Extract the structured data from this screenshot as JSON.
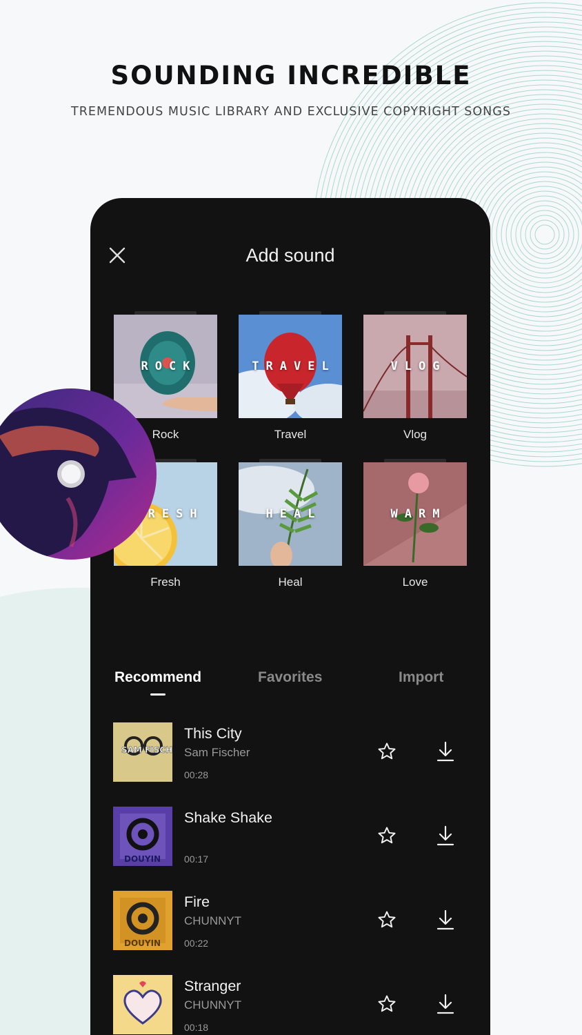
{
  "page": {
    "headline": "SOUNDING INCREDIBLE",
    "subline": "TREMENDOUS MUSIC LIBRARY AND EXCLUSIVE COPYRIGHT SONGS"
  },
  "colors": {
    "phone_bg": "#121212",
    "page_bg": "#f6f8fa",
    "ring_color": "#a9d8d0",
    "accent_white": "#ffffff",
    "muted_text": "#9a9a9a"
  },
  "screen": {
    "title": "Add sound",
    "close_icon": "close-icon",
    "categories": [
      {
        "label": "Rock",
        "cover_word": "ROCK"
      },
      {
        "label": "Travel",
        "cover_word": "TRAVEL"
      },
      {
        "label": "Vlog",
        "cover_word": "VLOG"
      },
      {
        "label": "Fresh",
        "cover_word": "FRESH"
      },
      {
        "label": "Heal",
        "cover_word": "HEAL"
      },
      {
        "label": "Love",
        "cover_word": "WARM"
      }
    ],
    "tabs": [
      {
        "label": "Recommend",
        "active": true
      },
      {
        "label": "Favorites",
        "active": false
      },
      {
        "label": "Import",
        "active": false
      }
    ],
    "songs": [
      {
        "title": "This City",
        "artist": "Sam Fischer",
        "duration": "00:28",
        "cover_text": "SAM FISCHER"
      },
      {
        "title": "Shake Shake",
        "artist": "",
        "duration": "00:17",
        "cover_text": "DOUYIN"
      },
      {
        "title": "Fire",
        "artist": "CHUNNYT",
        "duration": "00:22",
        "cover_text": "DOUYIN"
      },
      {
        "title": "Stranger",
        "artist": "CHUNNYT",
        "duration": "00:18",
        "cover_text": ""
      }
    ]
  }
}
